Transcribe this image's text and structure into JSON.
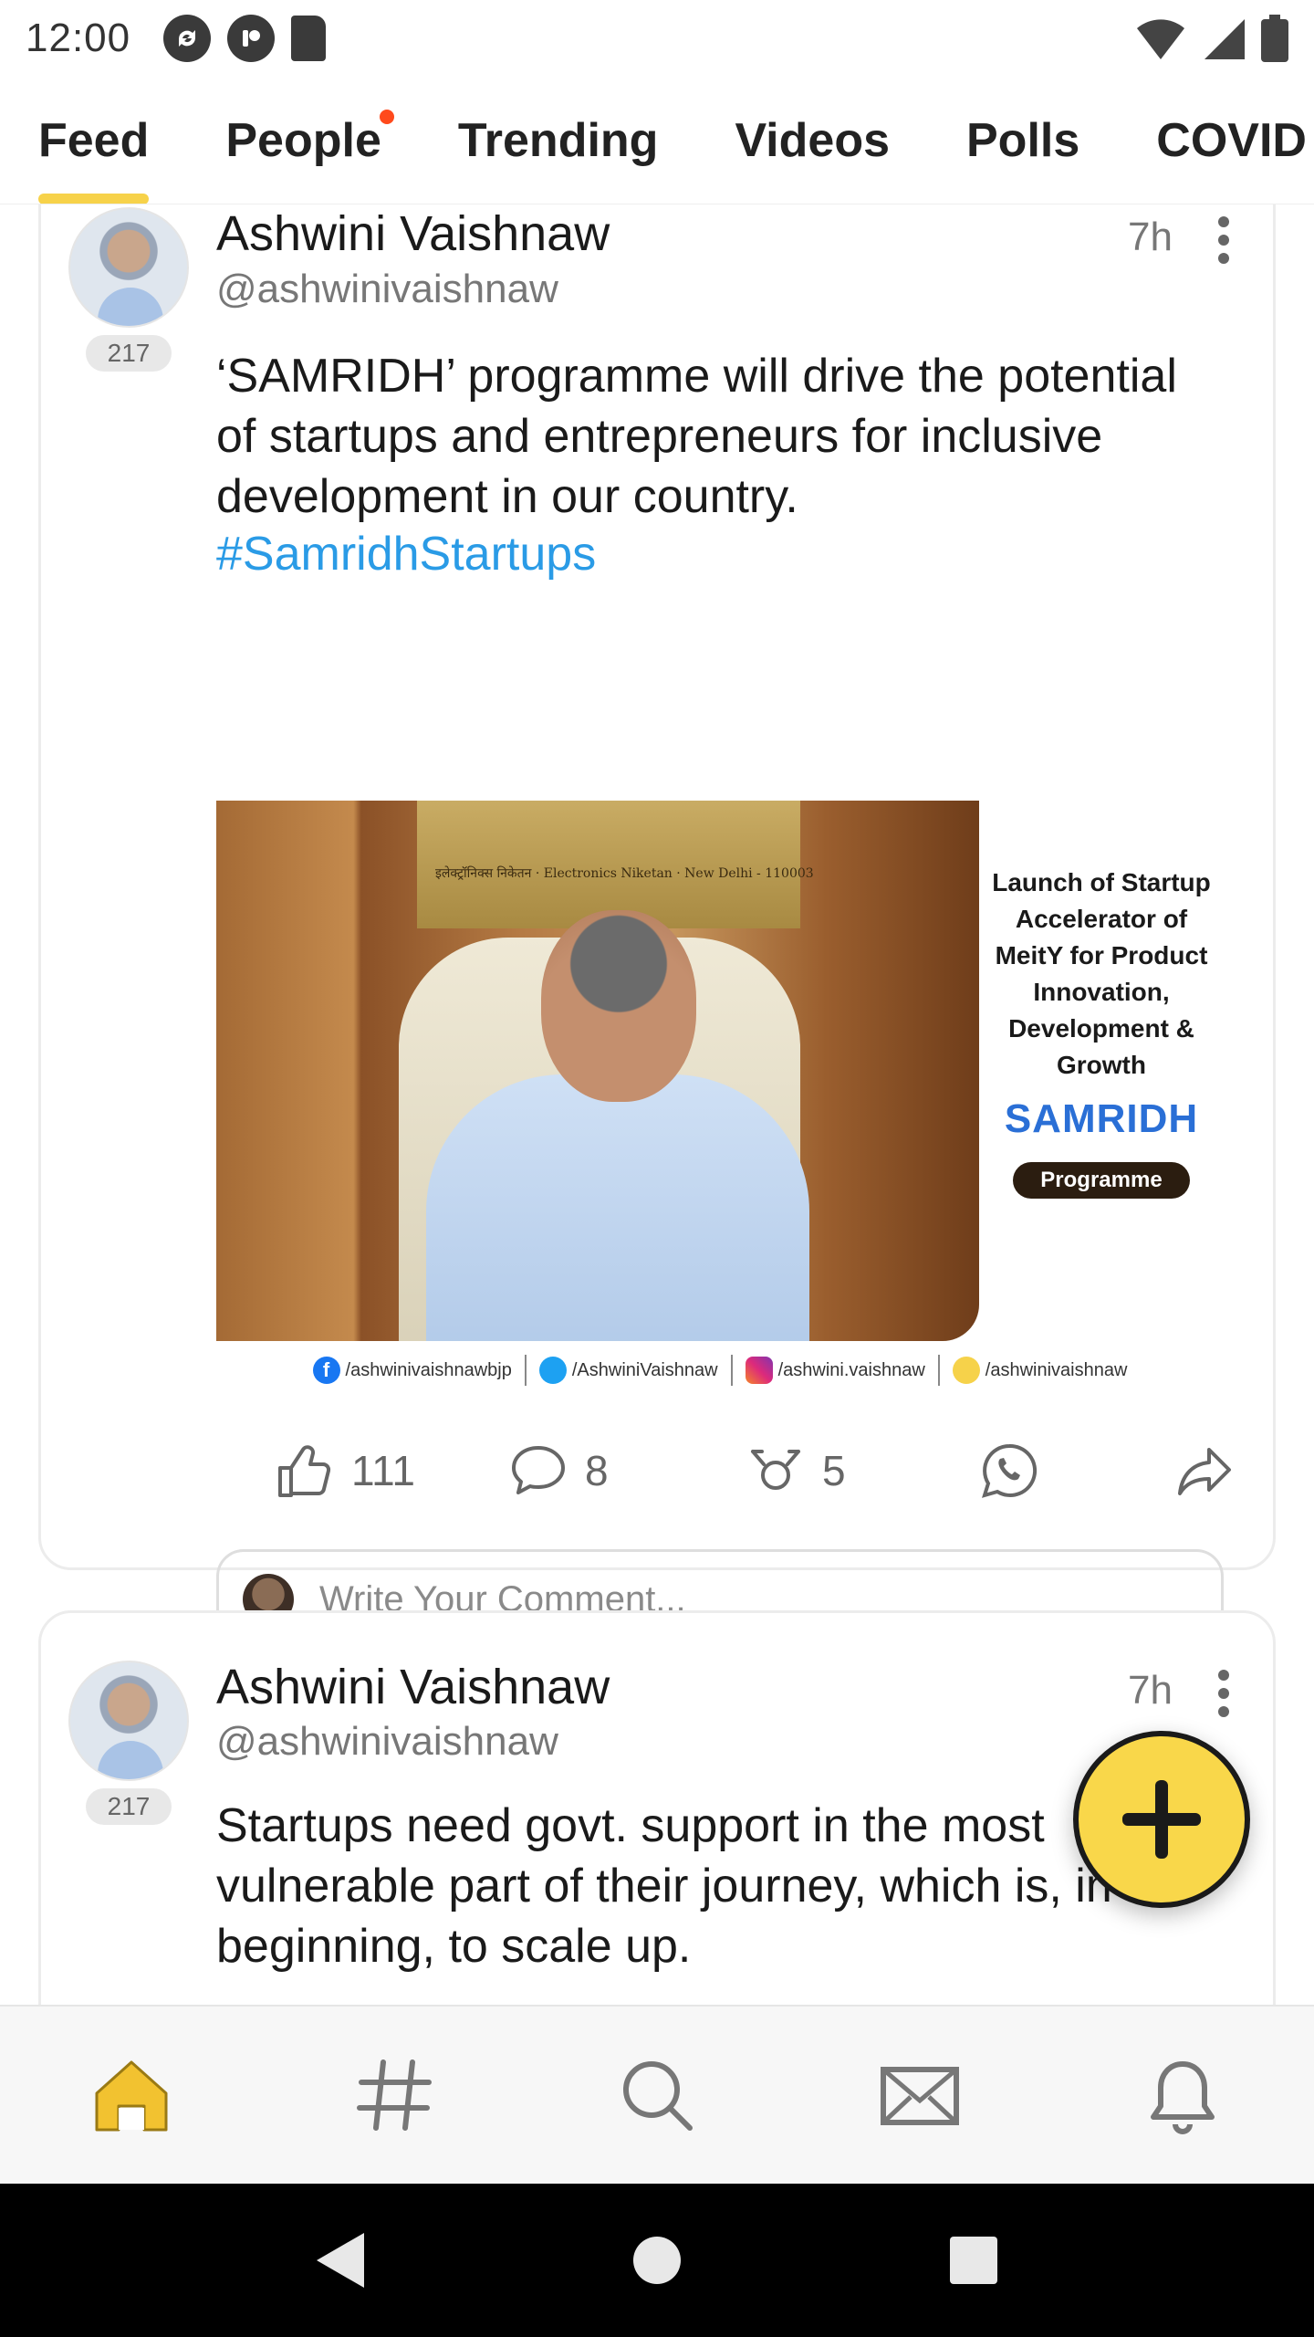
{
  "status_bar": {
    "time": "12:00"
  },
  "tabs": [
    {
      "label": "Feed",
      "active": true
    },
    {
      "label": "People",
      "has_notification_dot": true
    },
    {
      "label": "Trending"
    },
    {
      "label": "Videos"
    },
    {
      "label": "Polls"
    },
    {
      "label": "COVID"
    }
  ],
  "posts": [
    {
      "author": "Ashwini Vaishnaw",
      "handle": "@ashwinivaishnaw",
      "time": "7h",
      "avatar_count": "217",
      "text": "‘SAMRIDH’ programme will drive the potential of startups and entrepreneurs for inclusive development in our country.",
      "hashtag": "#SamridhStartups",
      "image": {
        "plaque_text": "इलेक्ट्रॉनिक्स निकेतन · Electronics Niketan · New Delhi - 110003",
        "promo_text": "Launch of Startup Accelerator of MeitY for Product Innovation, Development & Growth",
        "promo_title": "SAMRIDH",
        "promo_pill": "Programme",
        "social": {
          "facebook": "/ashwinivaishnawbjp",
          "twitter": "/AshwiniVaishnaw",
          "instagram": "/ashwini.vaishnaw",
          "koo": "/ashwinivaishnaw"
        }
      },
      "likes": "111",
      "comments": "8",
      "reposts": "5",
      "comment_placeholder": "Write Your Comment..."
    },
    {
      "author": "Ashwini Vaishnaw",
      "handle": "@ashwinivaishnaw",
      "time": "7h",
      "avatar_count": "217",
      "text": "Startups need govt. support in the most vulnerable part of their journey, which is, in the beginning, to scale up."
    }
  ],
  "bottom_nav": [
    {
      "icon": "home-icon",
      "active": true,
      "color": "#f2c230"
    },
    {
      "icon": "hashtag-icon"
    },
    {
      "icon": "search-icon"
    },
    {
      "icon": "mail-icon"
    },
    {
      "icon": "bell-icon"
    }
  ],
  "colors": {
    "accent": "#f9d74a",
    "hashtag": "#2a9be6",
    "notification_dot": "#ff4a1c"
  }
}
